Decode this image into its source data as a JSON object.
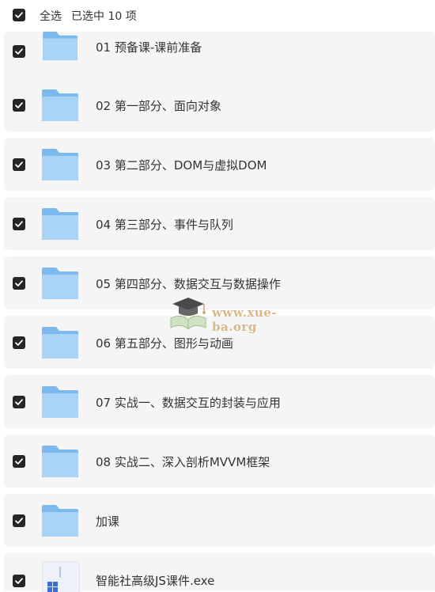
{
  "toolbar": {
    "select_all_label": "全选",
    "selected_text": "已选中  10  项"
  },
  "items": [
    {
      "label": "01 预备课-课前准备",
      "type": "folder",
      "checked": true
    },
    {
      "label": "02 第一部分、面向对象",
      "type": "folder",
      "checked": true
    },
    {
      "label": "03 第二部分、DOM与虚拟DOM",
      "type": "folder",
      "checked": true
    },
    {
      "label": "04 第三部分、事件与队列",
      "type": "folder",
      "checked": true
    },
    {
      "label": "05 第四部分、数据交互与数据操作",
      "type": "folder",
      "checked": true
    },
    {
      "label": "06 第五部分、图形与动画",
      "type": "folder",
      "checked": true
    },
    {
      "label": "07 实战一、数据交互的封装与应用",
      "type": "folder",
      "checked": true
    },
    {
      "label": "08 实战二、深入剖析MVVM框架",
      "type": "folder",
      "checked": true
    },
    {
      "label": "加课",
      "type": "folder",
      "checked": true
    },
    {
      "label": "智能社高级JS课件.exe",
      "type": "exe",
      "checked": true
    }
  ],
  "watermark": {
    "text": "www.xue-ba.org",
    "icon": "graduation-cap-book-icon"
  },
  "colors": {
    "checkbox": "#262626",
    "row_bg": "#f5f5f5",
    "folder_light": "#a9d3f7",
    "folder_dark": "#7cb9ee"
  }
}
